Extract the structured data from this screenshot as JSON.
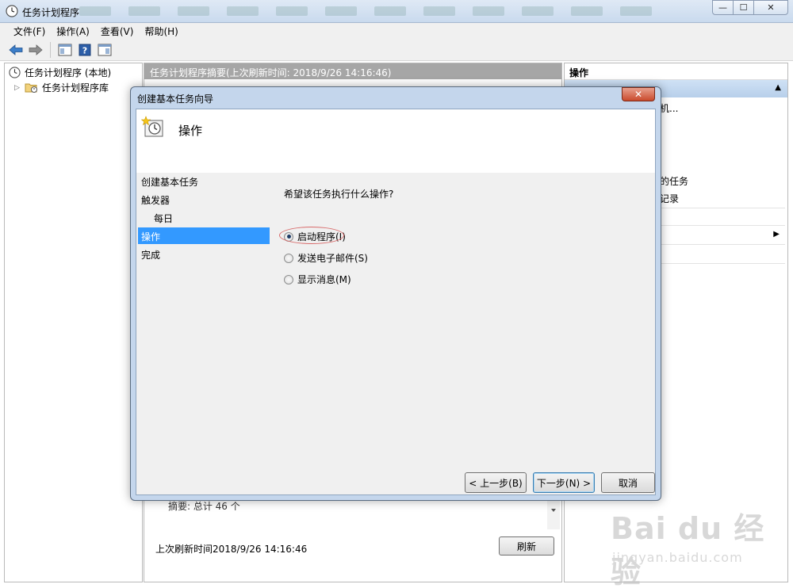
{
  "window": {
    "title": "任务计划程序",
    "controls": {
      "minimize": "—",
      "maximize": "☐",
      "close": "✕"
    }
  },
  "menu": {
    "items": [
      "文件(F)",
      "操作(A)",
      "查看(V)",
      "帮助(H)"
    ]
  },
  "toolbar": {
    "icons": [
      "back-arrow-icon",
      "forward-arrow-icon",
      "show-hide-tree-icon",
      "help-icon",
      "show-hide-action-pane-icon"
    ]
  },
  "tree": {
    "root_label": "任务计划程序 (本地)",
    "library_label": "任务计划程序库"
  },
  "center": {
    "summary_header": "任务计划程序摘要(上次刷新时间: 2018/9/26 14:16:46)",
    "summary_count": "摘要: 总计 46 个",
    "refresh_time": "上次刷新时间2018/9/26 14:16:46",
    "refresh_button": "刷新"
  },
  "actions_pane": {
    "header": "操作",
    "item_partial_1": "机...",
    "item_partial_2": "的任务",
    "item_partial_3": "记录"
  },
  "dialog": {
    "title": "创建基本任务向导",
    "close_glyph": "✕",
    "header_title": "操作",
    "steps": [
      {
        "label": "创建基本任务",
        "sub": false,
        "active": false
      },
      {
        "label": "触发器",
        "sub": false,
        "active": false
      },
      {
        "label": "每日",
        "sub": true,
        "active": false
      },
      {
        "label": "操作",
        "sub": false,
        "active": true
      },
      {
        "label": "完成",
        "sub": false,
        "active": false
      }
    ],
    "question": "希望该任务执行什么操作?",
    "options": [
      {
        "label": "启动程序(I)",
        "selected": true
      },
      {
        "label": "发送电子邮件(S)",
        "selected": false
      },
      {
        "label": "显示消息(M)",
        "selected": false
      }
    ],
    "buttons": {
      "back": "< 上一步(B)",
      "next": "下一步(N) >",
      "cancel": "取消"
    }
  },
  "watermark": {
    "brand": "Bai du 经验",
    "sub": "jingyan.baidu.com"
  }
}
